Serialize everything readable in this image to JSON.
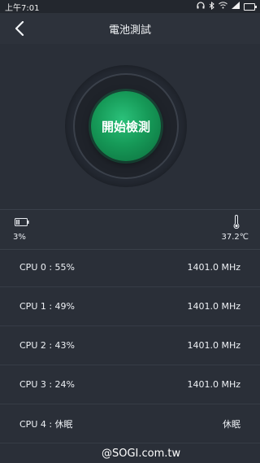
{
  "status_bar": {
    "time": "上午7:01",
    "icons": [
      "headphone-icon",
      "bluetooth-icon",
      "wifi-icon",
      "signal-icon",
      "battery-icon"
    ]
  },
  "header": {
    "title": "電池測試",
    "back_icon": "back-arrow-icon"
  },
  "hero": {
    "button_label": "開始檢測",
    "accent_color": "#169a58"
  },
  "summary": {
    "battery_level": "3%",
    "temperature": "37.2℃"
  },
  "cpus": [
    {
      "label": "CPU  0 : 55%",
      "value": "1401.0 MHz"
    },
    {
      "label": "CPU  1 : 49%",
      "value": "1401.0 MHz"
    },
    {
      "label": "CPU  2 : 43%",
      "value": "1401.0 MHz"
    },
    {
      "label": "CPU  3 : 24%",
      "value": "1401.0 MHz"
    },
    {
      "label": "CPU  4 : 休眠",
      "value": "休眠"
    }
  ],
  "watermark": "@SOGI.com.tw"
}
